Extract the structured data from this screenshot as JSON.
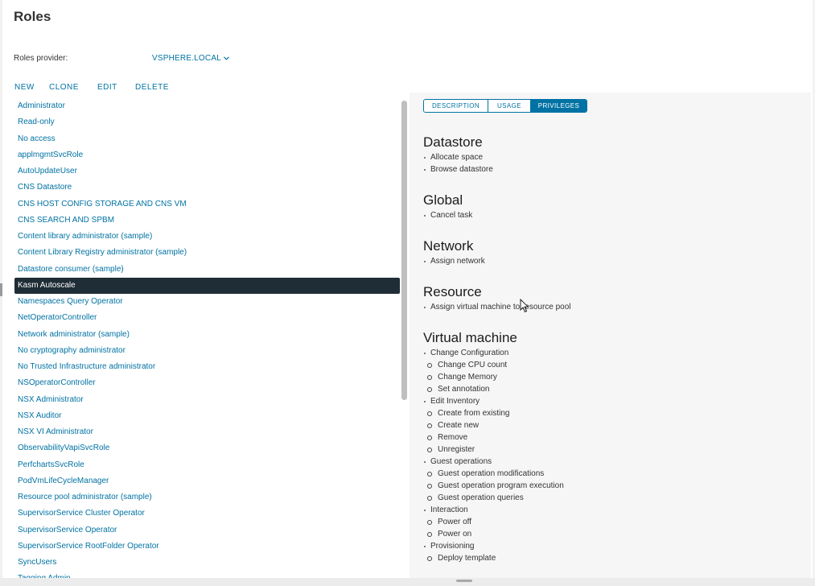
{
  "page": {
    "title": "Roles"
  },
  "provider": {
    "label": "Roles provider:",
    "value": "VSPHERE.LOCAL",
    "chevron_icon": "chevron-down-icon"
  },
  "toolbar": {
    "new": "NEW",
    "clone": "CLONE",
    "edit": "EDIT",
    "delete": "DELETE"
  },
  "roles": [
    "Administrator",
    "Read-only",
    "No access",
    "applmgmtSvcRole",
    "AutoUpdateUser",
    "CNS Datastore",
    "CNS HOST CONFIG STORAGE AND CNS VM",
    "CNS SEARCH AND SPBM",
    "Content library administrator (sample)",
    "Content Library Registry administrator (sample)",
    "Datastore consumer (sample)",
    "Kasm Autoscale",
    "Namespaces Query Operator",
    "NetOperatorController",
    "Network administrator (sample)",
    "No cryptography administrator",
    "No Trusted Infrastructure administrator",
    "NSOperatorController",
    "NSX Administrator",
    "NSX Auditor",
    "NSX VI Administrator",
    "ObservabilityVapiSvcRole",
    "PerfchartsSvcRole",
    "PodVmLifeCycleManager",
    "Resource pool administrator (sample)",
    "SupervisorService Cluster Operator",
    "SupervisorService Operator",
    "SupervisorService RootFolder Operator",
    "SyncUsers",
    "Tagging Admin"
  ],
  "selected_role": "Kasm Autoscale",
  "tabs": {
    "description": "DESCRIPTION",
    "usage": "USAGE",
    "privileges": "PRIVILEGES",
    "active": "PRIVILEGES"
  },
  "privileges": {
    "datastore": {
      "heading": "Datastore",
      "items": [
        "Allocate space",
        "Browse datastore"
      ]
    },
    "global": {
      "heading": "Global",
      "items": [
        "Cancel task"
      ]
    },
    "network": {
      "heading": "Network",
      "items": [
        "Assign network"
      ]
    },
    "resource": {
      "heading": "Resource",
      "items": [
        "Assign virtual machine to resource pool"
      ]
    },
    "virtual_machine": {
      "heading": "Virtual machine",
      "change_configuration": "Change Configuration",
      "change_cpu_count": "Change CPU count",
      "change_memory": "Change Memory",
      "set_annotation": "Set annotation",
      "edit_inventory": "Edit Inventory",
      "create_from_existing": "Create from existing",
      "create_new": "Create new",
      "remove": "Remove",
      "unregister": "Unregister",
      "guest_operations": "Guest operations",
      "guest_op_modifications": "Guest operation modifications",
      "guest_op_program_execution": "Guest operation program execution",
      "guest_op_queries": "Guest operation queries",
      "interaction": "Interaction",
      "power_off": "Power off",
      "power_on": "Power on",
      "provisioning": "Provisioning",
      "deploy_template": "Deploy template"
    }
  },
  "colors": {
    "link": "#0072a3",
    "selected_bg": "#1f2d36",
    "panel_bg": "#f6f6f6"
  }
}
